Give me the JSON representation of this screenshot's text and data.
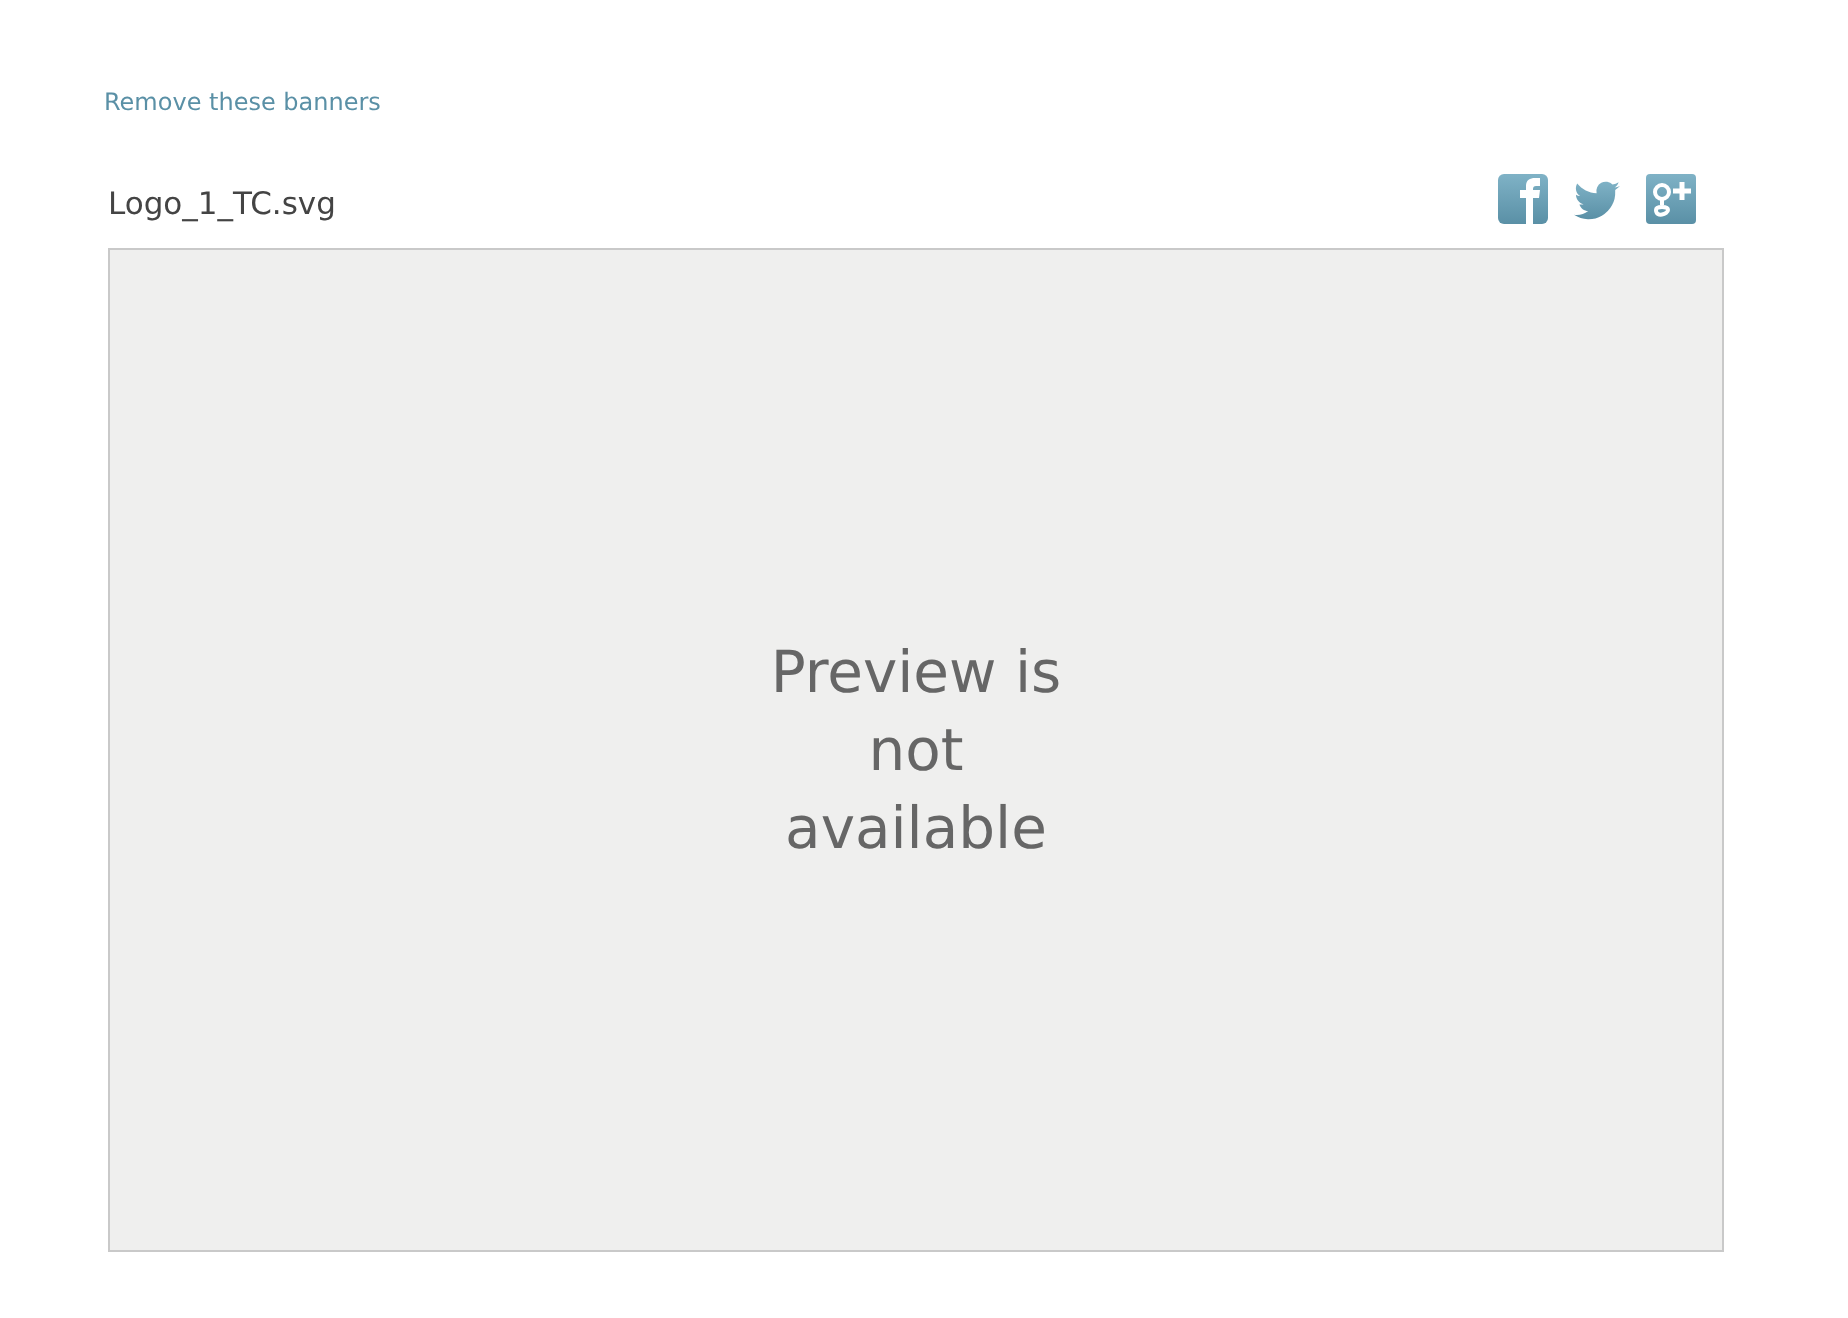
{
  "banner_link": "Remove these banners",
  "file_name": "Logo_1_TC.svg",
  "share_icons": [
    {
      "kind": "facebook"
    },
    {
      "kind": "twitter"
    },
    {
      "kind": "googleplus"
    }
  ],
  "preview": {
    "message": "Preview is not available"
  }
}
